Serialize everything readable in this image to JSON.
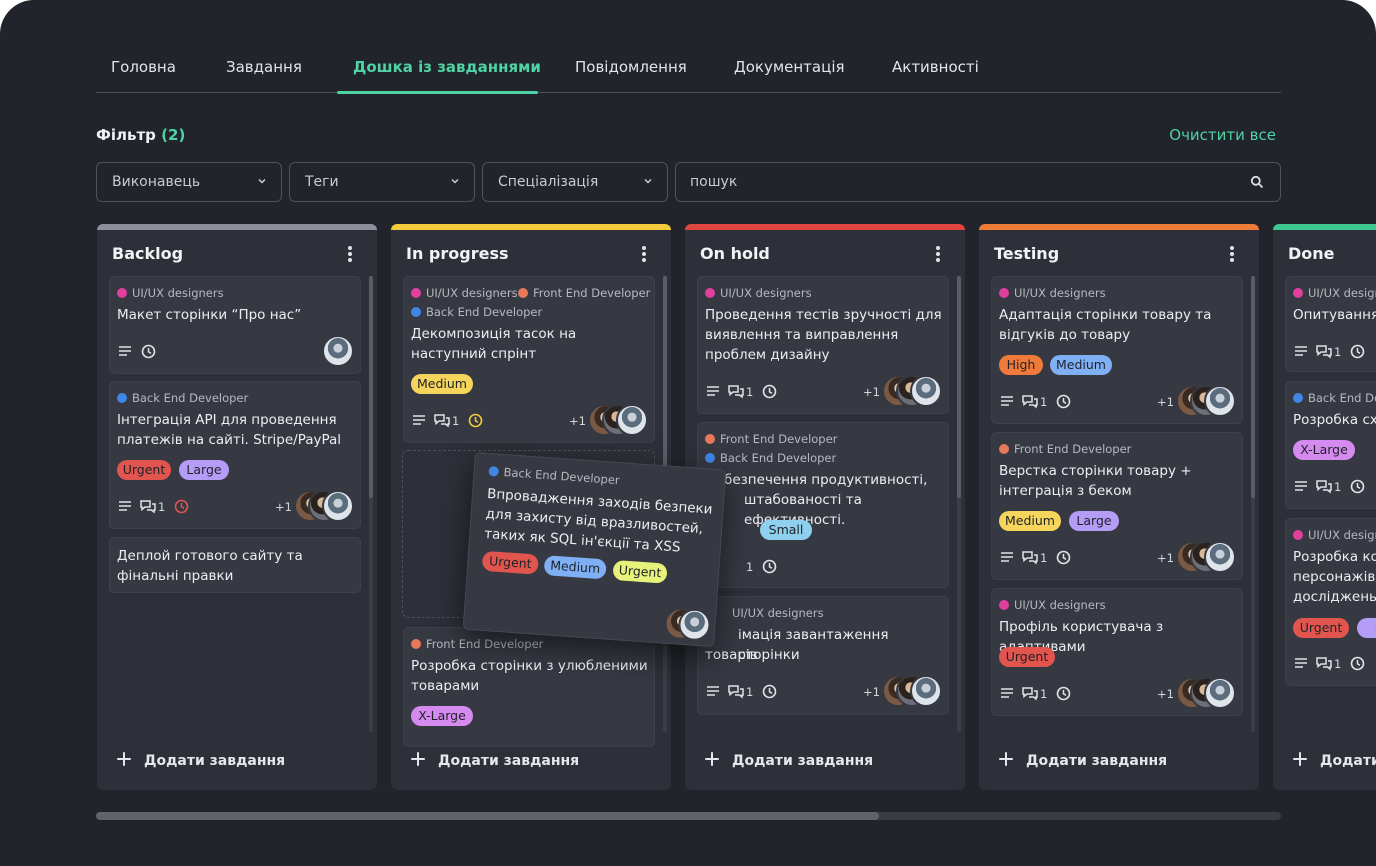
{
  "nav": {
    "tabs": [
      {
        "label": "Головна"
      },
      {
        "label": "Завдання"
      },
      {
        "label": "Дошка із завданнями",
        "active": true
      },
      {
        "label": "Повідомлення"
      },
      {
        "label": "Документація"
      },
      {
        "label": "Активності"
      }
    ]
  },
  "filter": {
    "title": "Фільтр",
    "count": "(2)",
    "clear_label": "Очистити все",
    "selects": [
      {
        "label": "Виконавець"
      },
      {
        "label": "Теги"
      },
      {
        "label": "Спеціалізація"
      }
    ],
    "search_placeholder": "пошук"
  },
  "colors": {
    "accent": "#4fd3a4",
    "ui_ux": "#e13fa0",
    "front_end": "#e5795a",
    "back_end": "#3f86e5",
    "urgent": "#e2554f",
    "large": "#b49cf7",
    "medium_yellow": "#f5d55b",
    "medium_blue": "#7fb0f5",
    "small": "#8fd0ef",
    "high": "#f07a3b",
    "x_large": "#d58af0"
  },
  "add_task_label": "Додати завдання",
  "columns": [
    {
      "title": "Backlog",
      "bar_color": "#8b909b",
      "cards": [
        {
          "spec": [
            "UI/UX designers"
          ],
          "title": "Макет сторінки “Про нас”"
        },
        {
          "spec": [
            "Back End Developer"
          ],
          "title": "Інтеграція API для проведення платежів на сайті. Stripe/PayPal",
          "tags": [
            "Urgent",
            "Large"
          ],
          "comments": "1",
          "plus": "+1"
        },
        {
          "title": "Деплой готового сайту та фінальні правки"
        }
      ]
    },
    {
      "title": "In progress",
      "bar_color": "#f3cb3a",
      "cards": [
        {
          "spec": [
            "UI/UX designers",
            "Front End Developer",
            "Back End Developer"
          ],
          "title": "Декомпозиція тасок на наступний спрінт",
          "tags": [
            "Medium"
          ],
          "comments": "1",
          "plus": "+1"
        },
        {
          "spec": [
            "Front End Developer"
          ],
          "title": "Розробка сторінки з улюбленими товарами",
          "tags": [
            "X-Large"
          ]
        }
      ]
    },
    {
      "title": "On hold",
      "bar_color": "#e0453f",
      "cards": [
        {
          "spec": [
            "UI/UX designers"
          ],
          "title": "Проведення тестів зручності для виявлення та виправлення проблем дизайну",
          "comments": "1",
          "plus": "+1"
        },
        {
          "spec": [
            "Front End Developer",
            "Back End Developer"
          ],
          "title_parts": [
            "безпечення продуктивності,",
            "штабованості та ефективності."
          ],
          "tags": [
            "Small"
          ],
          "comments": "1"
        },
        {
          "spec": [
            "UI/UX designers"
          ],
          "title_parts": [
            "імація завантаження сторінки",
            "товарів"
          ],
          "comments": "1",
          "plus": "+1"
        }
      ]
    },
    {
      "title": "Testing",
      "bar_color": "#ee7a38",
      "cards": [
        {
          "spec": [
            "UI/UX designers"
          ],
          "title": "Адаптація сторінки товару та відгуків до товару",
          "tags": [
            "High",
            "Medium"
          ],
          "comments": "1",
          "plus": "+1"
        },
        {
          "spec": [
            "Front End Developer"
          ],
          "title": "Верстка сторінки товару + інтеграція з беком",
          "tags": [
            "Medium",
            "Large"
          ],
          "comments": "1",
          "plus": "+1"
        },
        {
          "spec": [
            "UI/UX designers"
          ],
          "title": "Профіль користувача з адаптивами",
          "tags": [
            "Urgent"
          ],
          "comments": "1",
          "plus": "+1"
        }
      ]
    },
    {
      "title": "Done",
      "bar_color": "#3cc88f",
      "cards": [
        {
          "spec": [
            "UI/UX design"
          ],
          "title": "Опитування",
          "comments": "1"
        },
        {
          "spec": [
            "Back End Dev"
          ],
          "title": "Розробка сх",
          "tags": [
            "X-Large"
          ],
          "comments": "1"
        },
        {
          "spec": [
            "UI/UX design"
          ],
          "title_parts": [
            "Розробка кор",
            "персонажів к",
            "досліджень"
          ],
          "tags": [
            "Urgent",
            "La"
          ],
          "comments": "1"
        }
      ]
    }
  ],
  "dragged_card": {
    "spec": "Back End Developer",
    "title": "Впровадження заходів безпеки для захисту від вразливостей, таких як SQL ін'єкції та XSS",
    "tags": [
      "Urgent",
      "Medium",
      "Urgent"
    ]
  }
}
